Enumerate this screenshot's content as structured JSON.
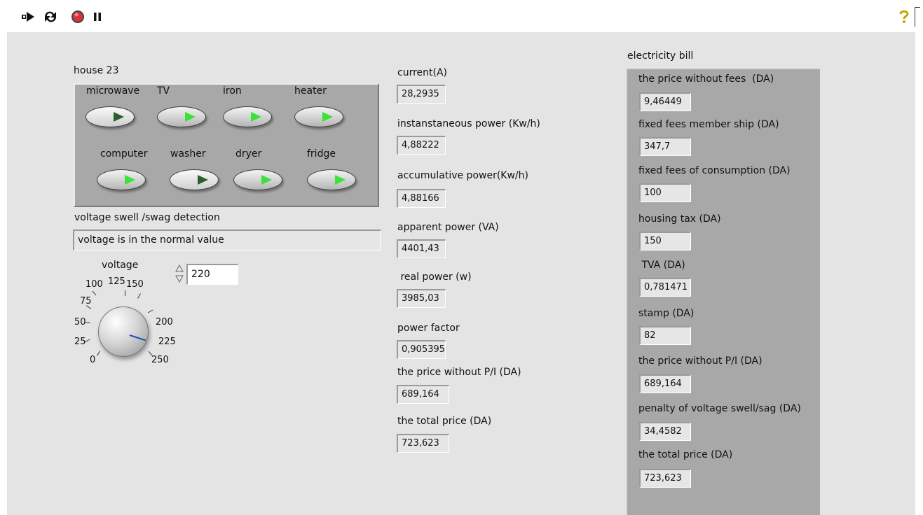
{
  "toolbar": {
    "run_icon": "run-arrow-icon",
    "run_continuously_icon": "run-continuously-icon",
    "abort_icon": "abort-stop-icon",
    "pause_icon": "pause-icon",
    "help_icon": "help-question-icon"
  },
  "house": {
    "title": "house 23",
    "appliances_row1": [
      "microwave",
      "TV",
      "iron",
      "heater"
    ],
    "appliances_row2": [
      "computer",
      "washer",
      "dryer",
      "fridge"
    ]
  },
  "voltage_detection": {
    "label": "voltage swell /swag detection",
    "value": "voltage is in the normal value"
  },
  "voltage": {
    "label": "voltage",
    "value": "220",
    "scale": [
      "0",
      "25",
      "50",
      "75",
      "100",
      "125",
      "150",
      "200",
      "225",
      "250"
    ],
    "range": [
      0,
      250
    ]
  },
  "measurements": [
    {
      "label": "current(A)",
      "value": "28,2935"
    },
    {
      "label": "instanstaneous power (Kw/h)",
      "value": "4,88222"
    },
    {
      "label": "accumulative power(Kw/h)",
      "value": "4,88166"
    },
    {
      "label": "apparent power (VA)",
      "value": "4401,43"
    },
    {
      "label": " real power (w)",
      "value": "3985,03"
    },
    {
      "label": "power factor",
      "value": "0,905395"
    },
    {
      "label": "the price without P/I (DA)",
      "value": "689,164"
    },
    {
      "label": "the total price (DA)",
      "value": "723,623"
    }
  ],
  "bill": {
    "title": "electricity bill",
    "items": [
      {
        "label": "the price without fees  (DA)",
        "value": "9,46449"
      },
      {
        "label": "fixed fees member ship (DA)",
        "value": "347,7"
      },
      {
        "label": "fixed fees of consumption (DA)",
        "value": "100"
      },
      {
        "label": "housing tax (DA)",
        "value": "150"
      },
      {
        "label": " TVA (DA)",
        "value": "0,781471"
      },
      {
        "label": "stamp (DA)",
        "value": "82"
      },
      {
        "label": "the price without P/I (DA)",
        "value": "689,164"
      },
      {
        "label": "penalty of voltage swell/sag (DA)",
        "value": "34,4582"
      },
      {
        "label": "the total price (DA)",
        "value": "723,623"
      }
    ]
  },
  "colors": {
    "led_on": "#3ae23a",
    "led_off": "#2d5f2d",
    "panel": "#a8a8a8",
    "background": "#e4e4e4",
    "abort": "#d8343a"
  }
}
